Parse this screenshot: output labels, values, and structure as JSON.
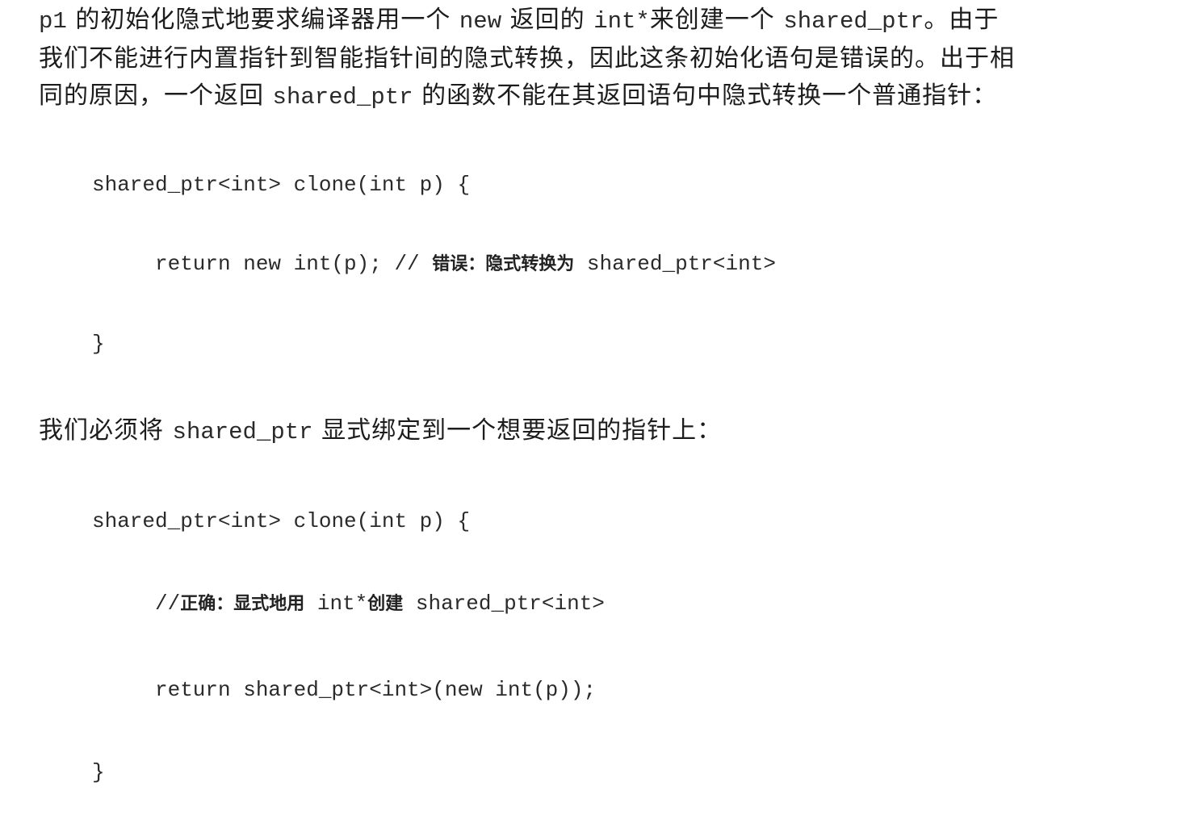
{
  "paragraph1": {
    "line1": [
      {
        "t": "mono",
        "v": "p1"
      },
      {
        "t": "text",
        "v": " 的初始化隐式地要求编译器用一个 "
      },
      {
        "t": "mono",
        "v": "new"
      },
      {
        "t": "text",
        "v": " 返回的 "
      },
      {
        "t": "mono",
        "v": "int*"
      },
      {
        "t": "text",
        "v": "来创建一个 "
      },
      {
        "t": "mono",
        "v": "shared_ptr"
      },
      {
        "t": "text",
        "v": "。由于"
      }
    ],
    "line2": [
      {
        "t": "text",
        "v": "我们不能进行内置指针到智能指针间的隐式转换，因此这条初始化语句是错误的。出于相"
      }
    ],
    "line3": [
      {
        "t": "text",
        "v": "同的原因，一个返回 "
      },
      {
        "t": "mono",
        "v": "shared_ptr"
      },
      {
        "t": "text",
        "v": " 的函数不能在其返回语句中隐式转换一个普通指针："
      }
    ]
  },
  "code1": {
    "line1": "shared_ptr<int> clone(int p) {",
    "line2_code": "return new int(p); // ",
    "line2_comment": "错误：隐式转换为",
    "line2_tail": " shared_ptr<int>",
    "line3": "}"
  },
  "paragraph2": [
    {
      "t": "text",
      "v": "我们必须将 "
    },
    {
      "t": "mono",
      "v": "shared_ptr"
    },
    {
      "t": "text",
      "v": " 显式绑定到一个想要返回的指针上："
    }
  ],
  "code2": {
    "line1": "shared_ptr<int> clone(int p) {",
    "line2_prefix": "//",
    "line2_comment": "正确：显式地用",
    "line2_mid": " int*",
    "line2_comment2": "创建",
    "line2_tail": " shared_ptr<int>",
    "line3": "return shared_ptr<int>(new int(p));",
    "line4": "}"
  }
}
